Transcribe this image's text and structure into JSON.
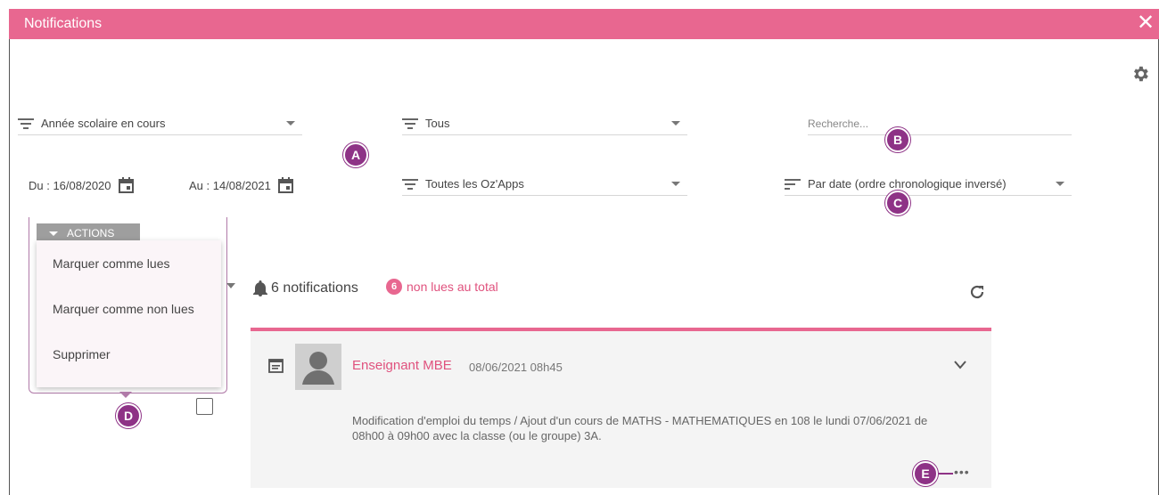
{
  "window": {
    "title": "Notifications",
    "close_glyph": "✕"
  },
  "filters": {
    "school_year": "Année scolaire en cours",
    "type": "Tous",
    "apps": "Toutes les Oz'Apps",
    "sort": "Par date (ordre chronologique inversé)",
    "search_placeholder": "Recherche...",
    "date_from": "Du : 16/08/2020",
    "date_to": "Au : 14/08/2021"
  },
  "actions": {
    "button_label": "ACTIONS",
    "menu": [
      "Marquer comme lues",
      "Marquer comme non lues",
      "Supprimer"
    ]
  },
  "summary": {
    "count_label": "6 notifications",
    "unread_count": "6",
    "unread_label": "non lues au total"
  },
  "notification": {
    "sender": "Enseignant MBE",
    "time": "08/06/2021 08h45",
    "message": "Modification d'emploi du temps / Ajout d'un cours de MATHS - MATHEMATIQUES en 108 le lundi 07/06/2021 de 08h00 à 09h00 avec la classe (ou le groupe) 3A.",
    "more": "•••"
  },
  "callouts": [
    "A",
    "B",
    "C",
    "D",
    "E"
  ],
  "colors": {
    "accent": "#e86790",
    "callout": "#8e3286"
  },
  "icons": [
    "close-icon",
    "gear-icon",
    "filter-icon",
    "sort-icon",
    "calendar-icon",
    "bell-icon",
    "refresh-icon",
    "schedule-icon",
    "avatar-icon",
    "chevron-down-icon"
  ]
}
